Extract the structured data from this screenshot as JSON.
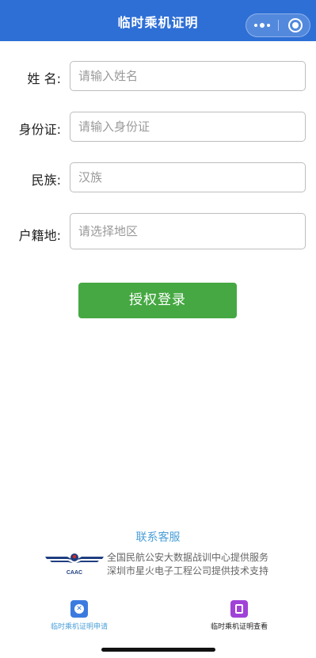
{
  "header": {
    "title": "临时乘机证明"
  },
  "form": {
    "name_label": "姓 名:",
    "name_placeholder": "请输入姓名",
    "id_label": "身份证:",
    "id_placeholder": "请输入身份证",
    "ethnicity_label": "民族:",
    "ethnicity_value": "汉族",
    "hukou_label": "户籍地:",
    "hukou_placeholder": "请选择地区",
    "submit_label": "授权登录"
  },
  "footer": {
    "contact_label": "联系客服",
    "logo_text": "CAAC",
    "credit_line1": "全国民航公安大数据战训中心提供服务",
    "credit_line2": "深圳市星火电子工程公司提供技术支持"
  },
  "tabs": [
    {
      "label": "临时乘机证明申请",
      "icon": "apply-icon",
      "active": true
    },
    {
      "label": "临时乘机证明查看",
      "icon": "certificate-icon",
      "active": false
    }
  ],
  "colors": {
    "nav": "#2e6fd6",
    "primary_button": "#45a842",
    "link": "#4a9fd8",
    "tab_icon_apply": "#3b7be0",
    "tab_icon_view": "#a042d8"
  }
}
